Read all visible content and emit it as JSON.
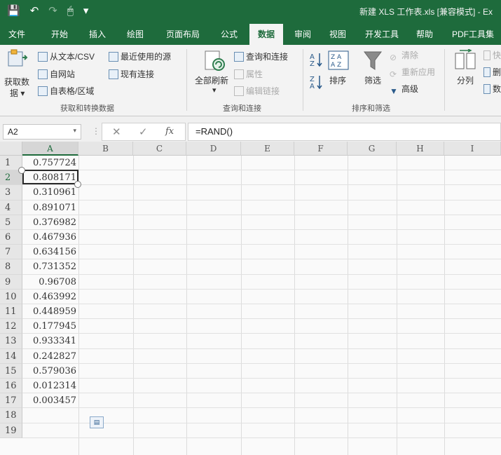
{
  "title_bar": {
    "title": "新建 XLS 工作表.xls  [兼容模式]  -  Ex",
    "qat": [
      "💾",
      "↶",
      "↷",
      "🖱",
      "▾"
    ]
  },
  "tabs": [
    "文件",
    "开始",
    "插入",
    "绘图",
    "页面布局",
    "公式",
    "数据",
    "审阅",
    "视图",
    "开发工具",
    "帮助",
    "PDF工具集"
  ],
  "active_tab": "数据",
  "ribbon": {
    "get_transform": {
      "get_data": "获取数",
      "get_data2": "据 ▾",
      "from_text_csv": "从文本/CSV",
      "from_web": "自网站",
      "from_table": "自表格/区域",
      "recent_sources": "最近使用的源",
      "existing_connections": "现有连接",
      "group_label": "获取和转换数据"
    },
    "queries": {
      "refresh_all": "全部刷新",
      "refresh_arrow": "▾",
      "queries_connections": "查询和连接",
      "properties": "属性",
      "edit_links": "编辑链接",
      "group_label": "查询和连接"
    },
    "sort_filter": {
      "sort": "排序",
      "filter": "筛选",
      "clear": "清除",
      "reapply": "重新应用",
      "advanced": "高级",
      "group_label": "排序和筛选"
    },
    "tools": {
      "text_to_columns": "分列",
      "partial1": "快",
      "partial2": "删",
      "partial3": "数"
    }
  },
  "formula_bar": {
    "name_box": "A2",
    "formula": "=RAND()",
    "cancel_icon": "✕",
    "enter_icon": "✓",
    "fx_icon": "fx"
  },
  "grid": {
    "columns": [
      "A",
      "B",
      "C",
      "D",
      "E",
      "F",
      "G",
      "H",
      "I"
    ],
    "selected_column": "A",
    "rows": [
      "1",
      "2",
      "3",
      "4",
      "5",
      "6",
      "7",
      "8",
      "9",
      "10",
      "11",
      "12",
      "13",
      "14",
      "15",
      "16",
      "17",
      "18",
      "19"
    ],
    "values": [
      "0.757724",
      "0.808171",
      "0.310961",
      "0.891071",
      "0.376982",
      "0.467936",
      "0.634156",
      "0.731352",
      "0.96708",
      "0.463992",
      "0.448959",
      "0.177945",
      "0.933341",
      "0.242827",
      "0.579036",
      "0.012314",
      "0.003457"
    ],
    "selected_row": "2"
  }
}
